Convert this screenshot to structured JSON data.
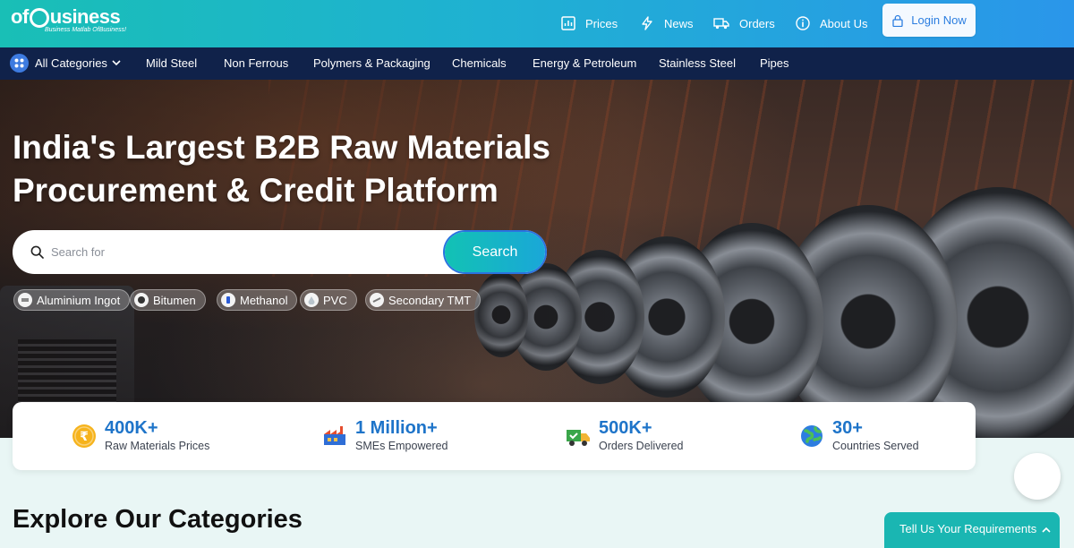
{
  "brand": {
    "name": "ofBusiness",
    "tagline": "Business Matlab OfBusiness!"
  },
  "topnav": {
    "items": [
      {
        "label": "Prices",
        "icon": "chart-icon"
      },
      {
        "label": "News",
        "icon": "lightning-icon"
      },
      {
        "label": "Orders",
        "icon": "truck-icon"
      },
      {
        "label": "About Us",
        "icon": "info-icon"
      }
    ],
    "login_label": "Login Now"
  },
  "catbar": {
    "all_label": "All Categories",
    "items": [
      "Mild Steel",
      "Non Ferrous",
      "Polymers & Packaging",
      "Chemicals",
      "Energy & Petroleum",
      "Stainless Steel",
      "Pipes"
    ]
  },
  "hero": {
    "title_line1": "India's Largest B2B Raw Materials",
    "title_line2": "Procurement & Credit Platform",
    "search_placeholder": "Search for",
    "search_button": "Search",
    "chips": [
      "Aluminium Ingot",
      "Bitumen",
      "Methanol",
      "PVC",
      "Secondary TMT"
    ]
  },
  "stats": [
    {
      "value": "400K+",
      "label": "Raw Materials Prices",
      "icon": "rupee-coin-icon"
    },
    {
      "value": "1 Million+",
      "label": "SMEs Empowered",
      "icon": "factory-icon"
    },
    {
      "value": "500K+",
      "label": "Orders Delivered",
      "icon": "delivery-truck-icon"
    },
    {
      "value": "30+",
      "label": "Countries Served",
      "icon": "globe-icon"
    }
  ],
  "sections": {
    "explore_title": "Explore Our Categories"
  },
  "tell_us": {
    "label": "Tell Us Your Requirements"
  },
  "colors": {
    "accent_teal": "#19bfb6",
    "accent_blue": "#2a96ea",
    "navbar_dark": "#10224a",
    "stat_value": "#1e74c9"
  }
}
